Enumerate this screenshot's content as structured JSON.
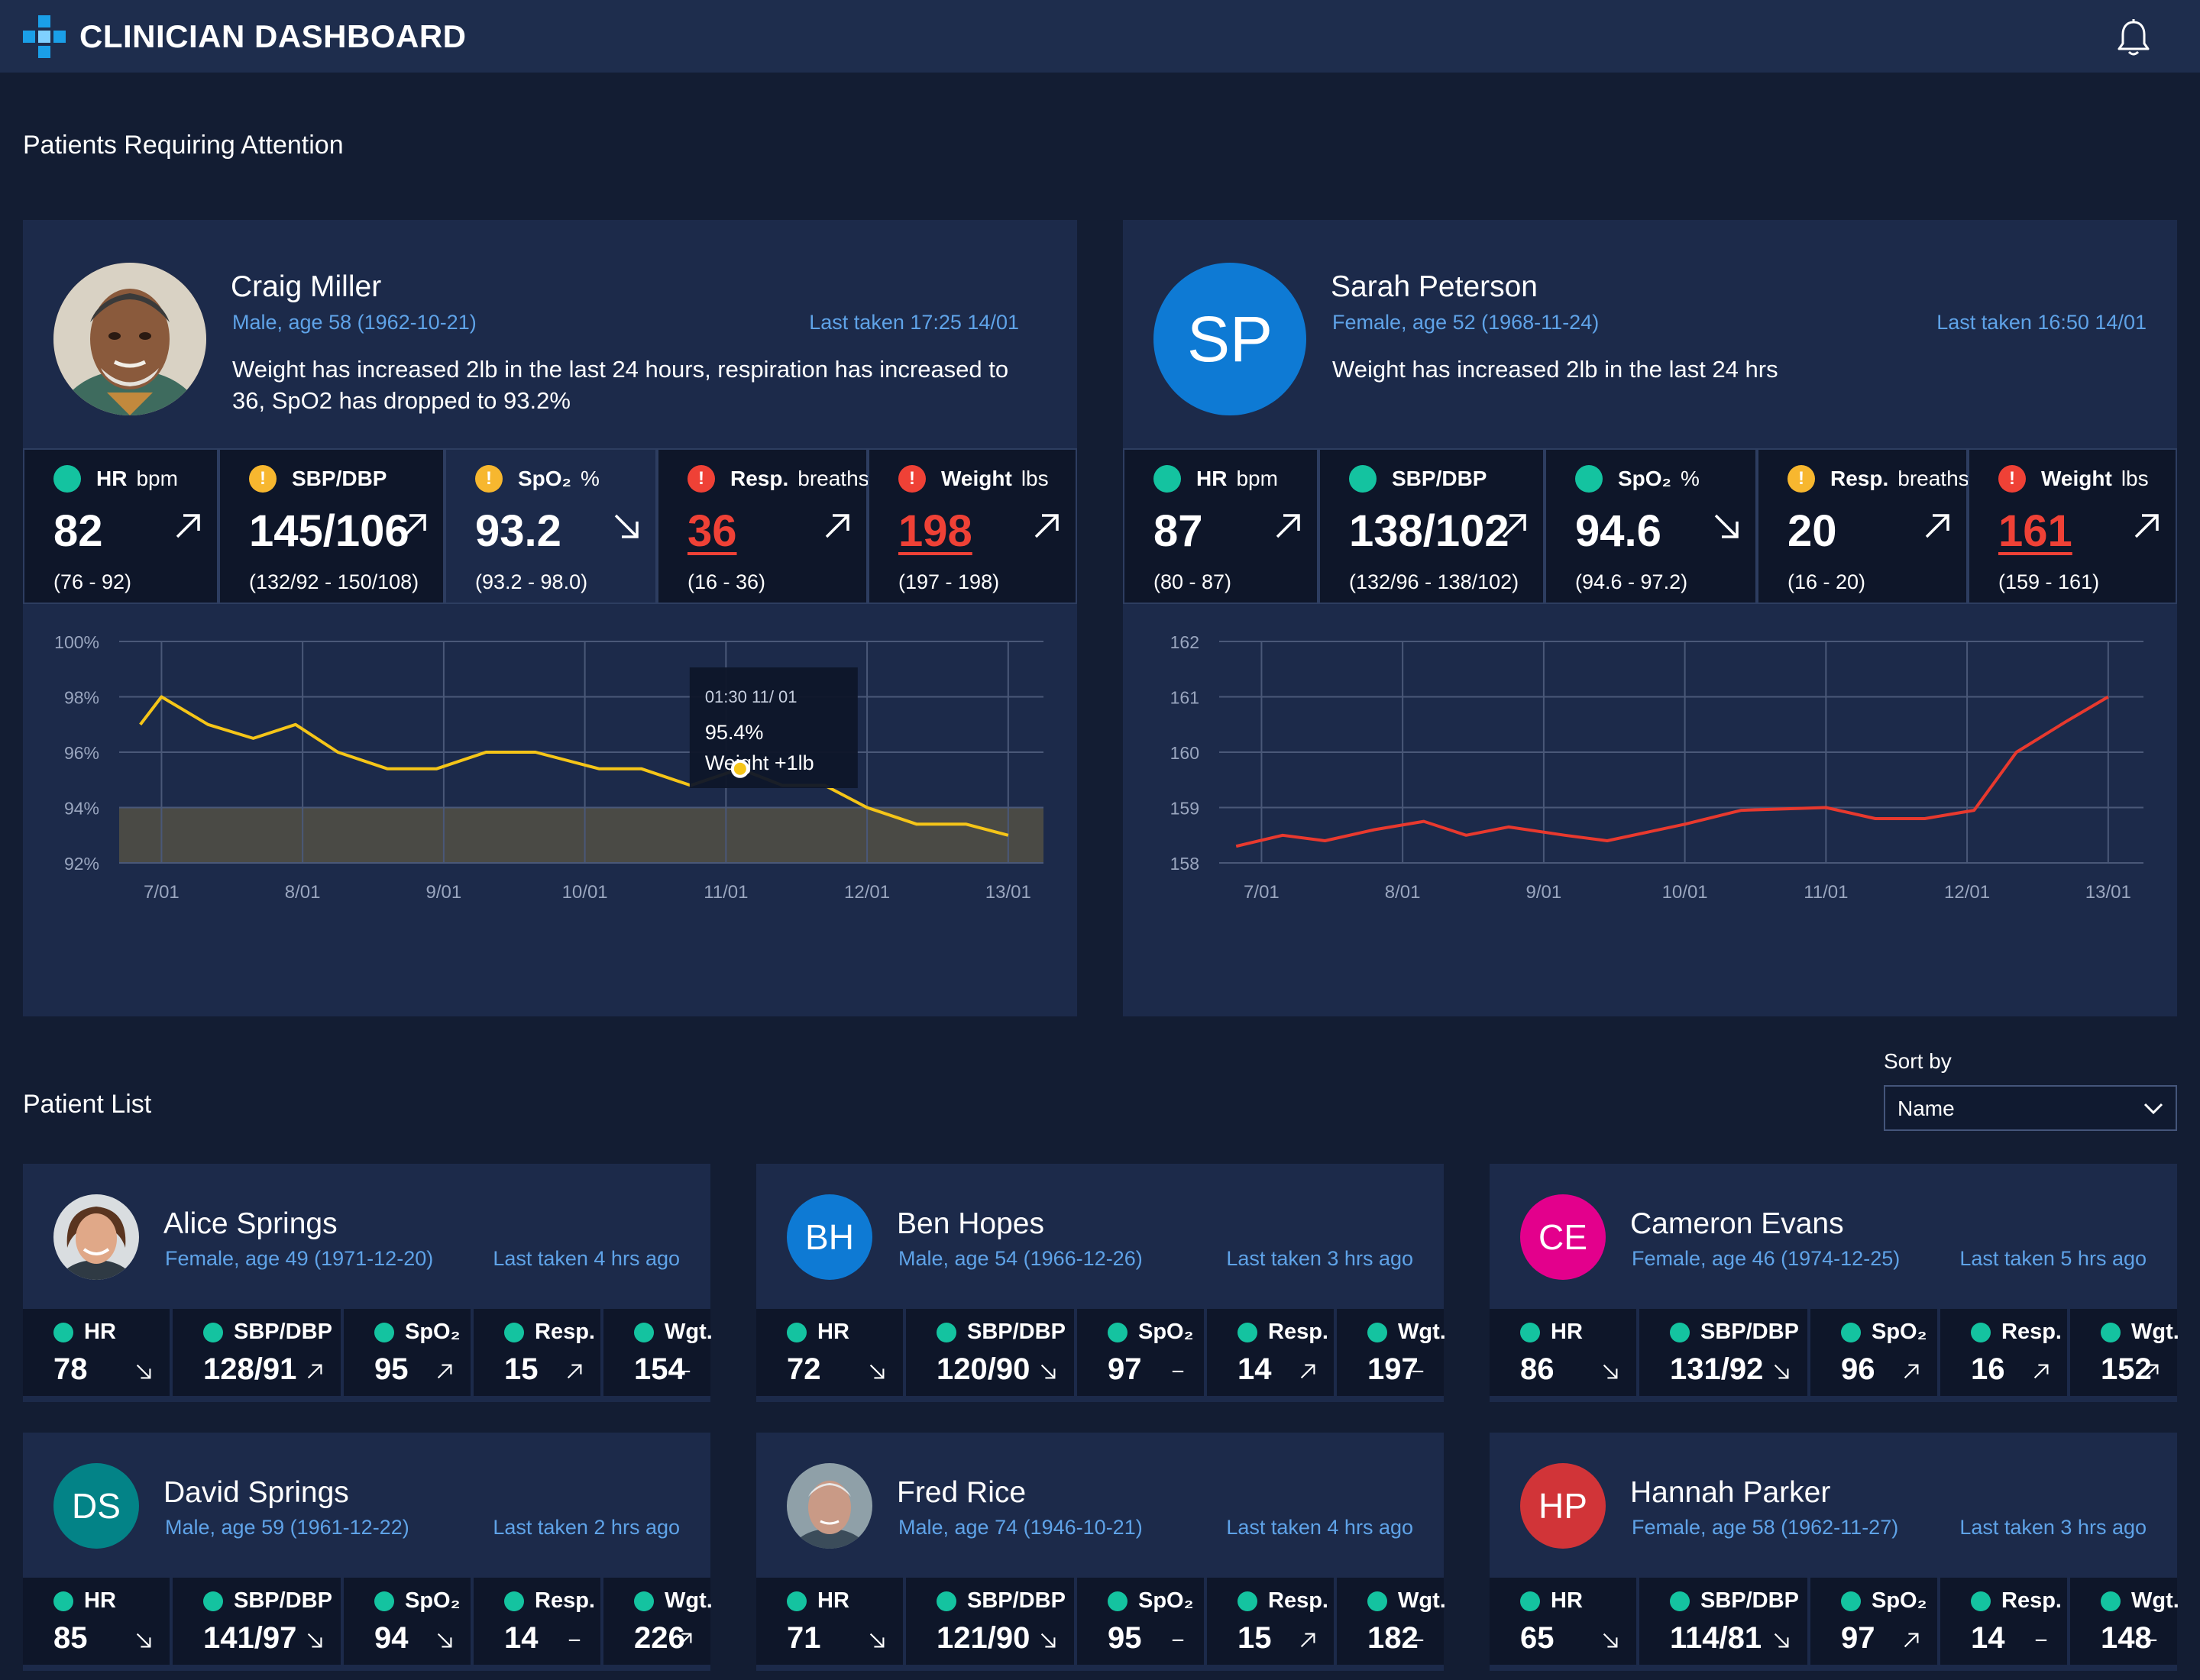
{
  "app": {
    "title": "CLINICIAN DASHBOARD"
  },
  "colors": {
    "teal": "#14c3a0",
    "amber": "#f7b72f",
    "red": "#ef4136",
    "accent_blue": "#5fa3e8",
    "chart_yellow": "#f5c518",
    "chart_red": "#e8392e",
    "card_bg": "#1c2a4a",
    "page_bg": "#131d33"
  },
  "attention": {
    "title": "Patients Requiring Attention",
    "patients": [
      {
        "name": "Craig Miller",
        "info": "Male, age 58 (1962-10-21)",
        "last_taken": "Last taken 17:25 14/01",
        "alert": "Weight has increased 2lb in the last 24 hours, respiration has increased to 36, SpO2 has dropped to 93.2%",
        "avatar": "photo",
        "vitals": [
          {
            "status": "teal",
            "label": "HR",
            "unit": "bpm",
            "value": "82",
            "range": "(76 - 92)",
            "trend": "up",
            "alert": false
          },
          {
            "status": "amber",
            "label": "SBP/DBP",
            "unit": "",
            "value": "145/106",
            "range": "(132/92 - 150/108)",
            "trend": "up",
            "alert": false
          },
          {
            "status": "amber",
            "label": "SpO₂",
            "unit": "%",
            "value": "93.2",
            "range": "(93.2 - 98.0)",
            "trend": "down",
            "alert": false
          },
          {
            "status": "red",
            "label": "Resp.",
            "unit": "breaths",
            "value": "36",
            "range": "(16 - 36)",
            "trend": "up",
            "alert": true
          },
          {
            "status": "red",
            "label": "Weight",
            "unit": "lbs",
            "value": "198",
            "range": "(197 - 198)",
            "trend": "up",
            "alert": true
          }
        ]
      },
      {
        "name": "Sarah Peterson",
        "info": "Female, age 52 (1968-11-24)",
        "last_taken": "Last taken 16:50 14/01",
        "alert": "Weight has increased 2lb in the last 24 hrs",
        "avatar": "SP",
        "vitals": [
          {
            "status": "teal",
            "label": "HR",
            "unit": "bpm",
            "value": "87",
            "range": "(80 - 87)",
            "trend": "up",
            "alert": false
          },
          {
            "status": "teal",
            "label": "SBP/DBP",
            "unit": "",
            "value": "138/102",
            "range": "(132/96 - 138/102)",
            "trend": "up",
            "alert": false
          },
          {
            "status": "teal",
            "label": "SpO₂",
            "unit": "%",
            "value": "94.6",
            "range": "(94.6 - 97.2)",
            "trend": "down",
            "alert": false
          },
          {
            "status": "amber",
            "label": "Resp.",
            "unit": "breaths",
            "value": "20",
            "range": "(16 - 20)",
            "trend": "up",
            "alert": false
          },
          {
            "status": "red",
            "label": "Weight",
            "unit": "lbs",
            "value": "161",
            "range": "(159 - 161)",
            "trend": "up",
            "alert": true
          }
        ]
      }
    ]
  },
  "chart_data": [
    {
      "type": "line",
      "series_name": "SpO2",
      "color": "#f5c518",
      "x_labels": [
        "7/01",
        "8/01",
        "9/01",
        "10/01",
        "11/01",
        "12/01",
        "13/01"
      ],
      "y_ticks": [
        "100%",
        "98%",
        "96%",
        "94%",
        "92%"
      ],
      "ylim": [
        92,
        100
      ],
      "threshold_below": 94,
      "x": [
        6.85,
        7.0,
        7.33,
        7.65,
        7.95,
        8.25,
        8.6,
        8.95,
        9.3,
        9.65,
        10.1,
        10.4,
        10.75,
        11.1,
        11.4,
        11.7,
        12.0,
        12.35,
        12.7,
        13.0
      ],
      "y": [
        97.0,
        98.0,
        97.0,
        96.5,
        97.0,
        96.0,
        95.4,
        95.4,
        96.0,
        96.0,
        95.4,
        95.4,
        94.8,
        95.4,
        94.8,
        94.8,
        94.0,
        93.4,
        93.4,
        93.0
      ],
      "tooltip": {
        "time": "01:30 11/ 01",
        "value": "95.4%",
        "note": "Weight +1lb",
        "x": 11.1,
        "y": 95.4
      }
    },
    {
      "type": "line",
      "series_name": "Weight",
      "color": "#e8392e",
      "x_labels": [
        "7/01",
        "8/01",
        "9/01",
        "10/01",
        "11/01",
        "12/01",
        "13/01"
      ],
      "y_ticks": [
        "162",
        "161",
        "160",
        "159",
        "158"
      ],
      "ylim": [
        158,
        162
      ],
      "x": [
        6.82,
        7.15,
        7.45,
        7.8,
        8.15,
        8.45,
        8.75,
        9.15,
        9.45,
        10.0,
        10.4,
        11.0,
        11.35,
        11.7,
        12.05,
        12.35,
        12.7,
        13.0
      ],
      "y": [
        158.3,
        158.5,
        158.4,
        158.6,
        158.75,
        158.5,
        158.65,
        158.5,
        158.4,
        158.7,
        158.95,
        159.0,
        158.8,
        158.8,
        158.95,
        160.0,
        160.55,
        161.0
      ]
    }
  ],
  "patient_list": {
    "title": "Patient List",
    "sort_label": "Sort by",
    "sort_value": "Name",
    "vital_labels": [
      "HR",
      "SBP/DBP",
      "SpO₂",
      "Resp.",
      "Wgt."
    ],
    "patients": [
      {
        "name": "Alice Springs",
        "info": "Female, age 49 (1971-12-20)",
        "last_taken": "Last taken 4 hrs ago",
        "avatar": "photo-woman",
        "initials": "",
        "color": "",
        "values": [
          "78",
          "128/91",
          "95",
          "15",
          "154"
        ],
        "trends": [
          "down",
          "up",
          "up",
          "up",
          "flat"
        ]
      },
      {
        "name": "Ben Hopes",
        "info": "Male, age 54 (1966-12-26)",
        "last_taken": "Last taken 3 hrs ago",
        "avatar": "initials",
        "initials": "BH",
        "color": "#0e7ad4",
        "values": [
          "72",
          "120/90",
          "97",
          "14",
          "197"
        ],
        "trends": [
          "down",
          "down",
          "flat",
          "up",
          "flat"
        ]
      },
      {
        "name": "Cameron Evans",
        "info": "Female, age 46 (1974-12-25)",
        "last_taken": "Last taken 5 hrs ago",
        "avatar": "initials",
        "initials": "CE",
        "color": "#e3008c",
        "values": [
          "86",
          "131/92",
          "96",
          "16",
          "152"
        ],
        "trends": [
          "down",
          "down",
          "up",
          "up",
          "up"
        ]
      },
      {
        "name": "David Springs",
        "info": "Male, age 59 (1961-12-22)",
        "last_taken": "Last taken 2 hrs ago",
        "avatar": "initials",
        "initials": "DS",
        "color": "#038387",
        "values": [
          "85",
          "141/97",
          "94",
          "14",
          "226"
        ],
        "trends": [
          "down",
          "down",
          "down",
          "flat",
          "up"
        ]
      },
      {
        "name": "Fred Rice",
        "info": "Male, age 74 (1946-10-21)",
        "last_taken": "Last taken 4 hrs ago",
        "avatar": "photo-old",
        "initials": "",
        "color": "",
        "values": [
          "71",
          "121/90",
          "95",
          "15",
          "182"
        ],
        "trends": [
          "down",
          "down",
          "flat",
          "up",
          "flat"
        ]
      },
      {
        "name": "Hannah Parker",
        "info": "Female, age 58 (1962-11-27)",
        "last_taken": "Last taken 3 hrs ago",
        "avatar": "initials",
        "initials": "HP",
        "color": "#d13438",
        "values": [
          "65",
          "114/81",
          "97",
          "14",
          "148"
        ],
        "trends": [
          "down",
          "down",
          "up",
          "flat",
          "flat"
        ]
      }
    ]
  }
}
